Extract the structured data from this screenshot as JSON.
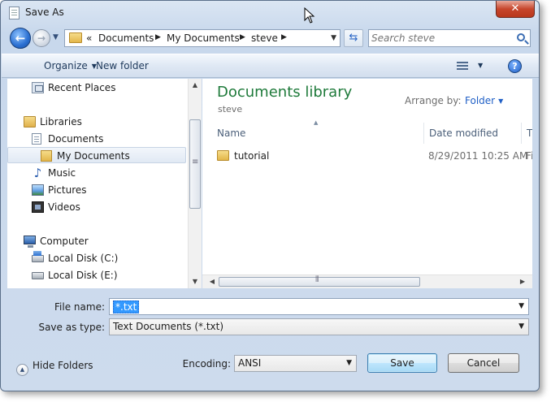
{
  "window": {
    "title": "Save As"
  },
  "address": {
    "overflow": "«",
    "crumbs": [
      "Documents",
      "My Documents",
      "steve"
    ]
  },
  "search": {
    "placeholder": "Search steve"
  },
  "toolbar": {
    "organize": "Organize",
    "new_folder": "New folder"
  },
  "nav": {
    "items": [
      {
        "label": "Recent Places",
        "icon": "recent-places-icon"
      },
      {
        "label": "Libraries",
        "icon": "libraries-icon"
      },
      {
        "label": "Documents",
        "icon": "documents-icon"
      },
      {
        "label": "My Documents",
        "icon": "my-documents-icon",
        "selected": true
      },
      {
        "label": "Music",
        "icon": "music-icon"
      },
      {
        "label": "Pictures",
        "icon": "pictures-icon"
      },
      {
        "label": "Videos",
        "icon": "videos-icon"
      },
      {
        "label": "Computer",
        "icon": "computer-icon"
      },
      {
        "label": "Local Disk (C:)",
        "icon": "disk-icon"
      },
      {
        "label": "Local Disk (E:)",
        "icon": "disk-icon"
      }
    ]
  },
  "library": {
    "title": "Documents library",
    "subtitle": "steve",
    "arrange_label": "Arrange by:",
    "arrange_value": "Folder"
  },
  "columns": [
    "Name",
    "Date modified",
    "T"
  ],
  "files": [
    {
      "name": "tutorial",
      "date": "8/29/2011 10:25 AM",
      "type": "Fi"
    }
  ],
  "form": {
    "file_name_label": "File name:",
    "file_name_value": "*.txt",
    "save_type_label": "Save as type:",
    "save_type_value": "Text Documents (*.txt)",
    "encoding_label": "Encoding:",
    "encoding_value": "ANSI",
    "hide_folders": "Hide Folders",
    "save": "Save",
    "cancel": "Cancel"
  },
  "colors": {
    "library_title": "#1e7a3a",
    "link": "#1f5fc6",
    "selection": "#3399ff"
  }
}
